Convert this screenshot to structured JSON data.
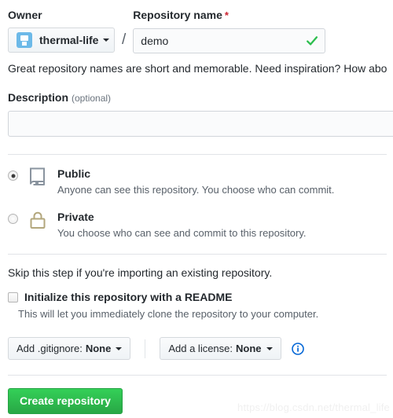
{
  "owner": {
    "label": "Owner",
    "name": "thermal-life",
    "avatar_icon": "user-avatar-icon",
    "caret_icon": "chevron-down-icon"
  },
  "separator": "/",
  "repo_name": {
    "label": "Repository name",
    "required_marker": "*",
    "value": "demo",
    "placeholder": "",
    "valid_icon": "check-icon",
    "valid_color": "#2cbe4e"
  },
  "help_text": "Great repository names are short and memorable. Need inspiration? How abo",
  "description": {
    "label": "Description",
    "optional_note": "(optional)",
    "value": "",
    "placeholder": ""
  },
  "visibility": {
    "options": [
      {
        "title": "Public",
        "subtitle": "Anyone can see this repository. You choose who can commit.",
        "icon": "repo-book-icon",
        "icon_color": "#8a949f",
        "selected": true
      },
      {
        "title": "Private",
        "subtitle": "You choose who can see and commit to this repository.",
        "icon": "lock-icon",
        "icon_color": "#b3a77d",
        "selected": false
      }
    ]
  },
  "init": {
    "skip_text": "Skip this step if you're importing an existing repository.",
    "readme_label": "Initialize this repository with a README",
    "readme_sub": "This will let you immediately clone the repository to your computer.",
    "readme_checked": false
  },
  "dropdowns": {
    "gitignore": {
      "lead": "Add .gitignore:",
      "value": "None",
      "caret_icon": "chevron-down-icon"
    },
    "license": {
      "lead": "Add a license:",
      "value": "None",
      "caret_icon": "chevron-down-icon"
    },
    "info_icon": "info-circle-icon",
    "info_color": "#0366d6"
  },
  "submit": {
    "label": "Create repository",
    "color": "#28a745"
  },
  "watermark": "https://blog.csdn.net/thermal_life"
}
